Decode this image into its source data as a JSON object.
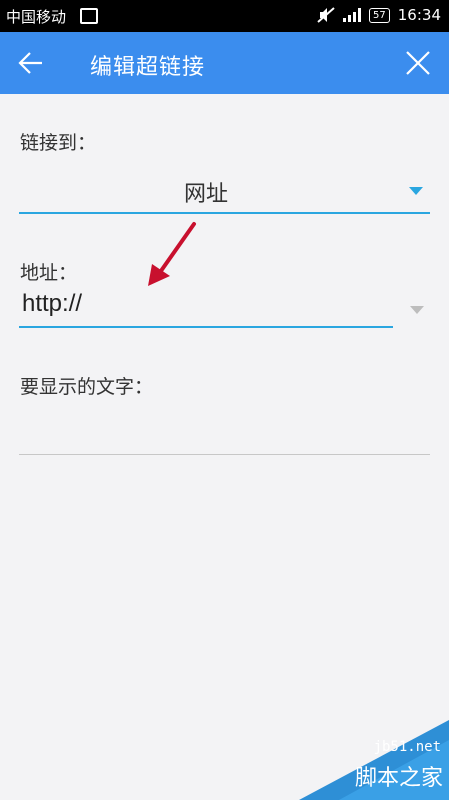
{
  "status_bar": {
    "carrier": "中国移动",
    "battery": "57",
    "time": "16:34"
  },
  "toolbar": {
    "title": "编辑超链接",
    "back_icon": "arrow-left-icon",
    "close_icon": "close-icon"
  },
  "form": {
    "link_to_label": "链接到：",
    "link_to_value": "网址",
    "address_label": "地址：",
    "address_value": "http://",
    "display_text_label": "要显示的文字：",
    "display_text_value": ""
  },
  "annotation": {
    "arrow_color": "#c8102e"
  },
  "watermark": {
    "site": "jb51.net",
    "name": "脚本之家"
  },
  "colors": {
    "toolbar": "#3b8dee",
    "accent_underline": "#2aa6e0"
  }
}
